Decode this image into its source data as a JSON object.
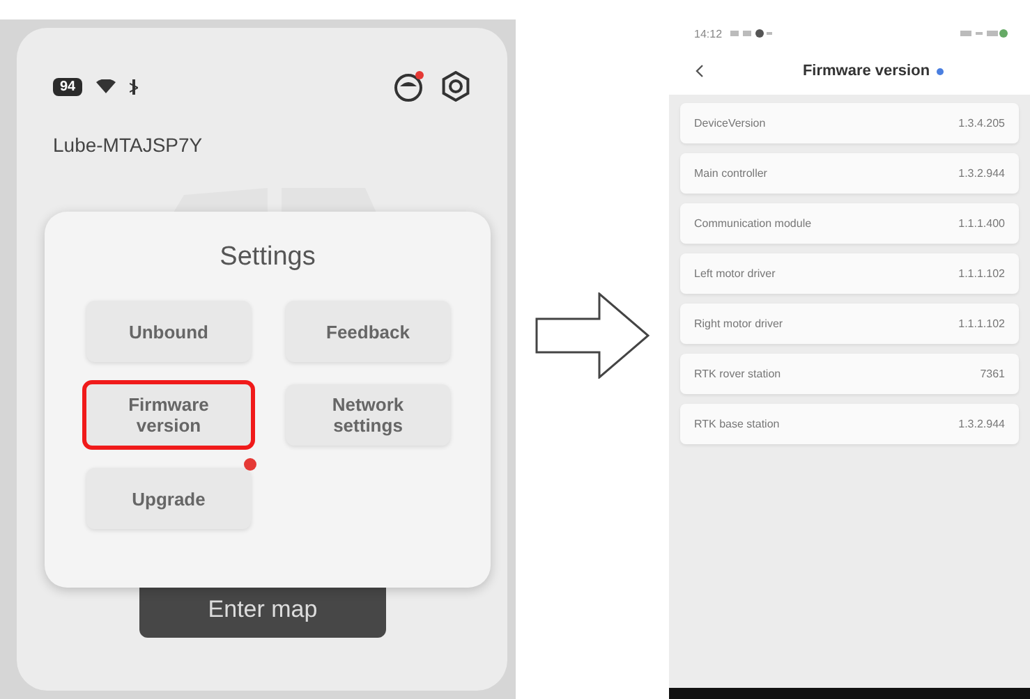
{
  "settings_screen": {
    "battery": "94",
    "device_name": "Lube-MTAJSP7Y",
    "robot_alert": true,
    "dialog": {
      "title": "Settings",
      "buttons": [
        {
          "label": "Unbound",
          "selected": false,
          "badge": false
        },
        {
          "label": "Feedback",
          "selected": false,
          "badge": false
        },
        {
          "label": "Firmware version",
          "selected": true,
          "badge": false
        },
        {
          "label": "Network settings",
          "selected": false,
          "badge": false
        },
        {
          "label": "Upgrade",
          "selected": false,
          "badge": true
        }
      ]
    },
    "enter_map_button": "Enter map"
  },
  "firmware_screen": {
    "status_time": "14:12",
    "title": "Firmware version",
    "rows": [
      {
        "name": "DeviceVersion",
        "value": "1.3.4.205"
      },
      {
        "name": "Main controller",
        "value": "1.3.2.944"
      },
      {
        "name": "Communication module",
        "value": "1.1.1.400"
      },
      {
        "name": "Left motor driver",
        "value": "1.1.1.102"
      },
      {
        "name": "Right motor driver",
        "value": "1.1.1.102"
      },
      {
        "name": "RTK rover station",
        "value": "7361"
      },
      {
        "name": "RTK base station",
        "value": "1.3.2.944"
      }
    ]
  }
}
